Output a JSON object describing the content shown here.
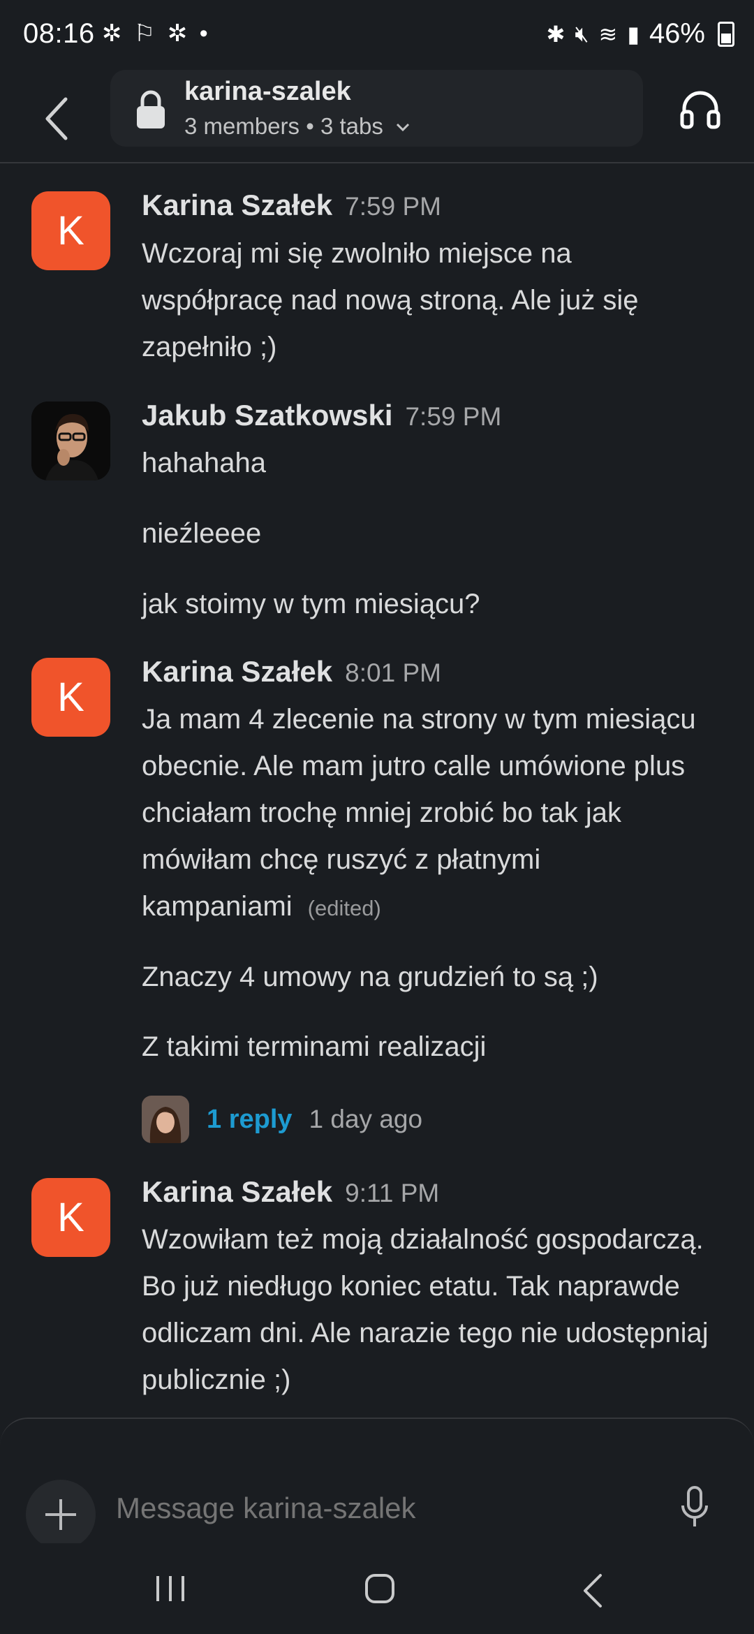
{
  "status": {
    "time": "08:16",
    "left_icons": "✲ ⚐ ✲ •",
    "battery": "46%"
  },
  "header": {
    "channel_name": "karina-szalek",
    "meta": "3 members • 3 tabs"
  },
  "messages": [
    {
      "author": "Karina Szałek",
      "time": "7:59 PM",
      "avatar_letter": "K",
      "lines": [
        "Wczoraj mi się zwolniło miejsce na współpracę nad nową stroną. Ale już się zapełniło ;)"
      ]
    },
    {
      "author": "Jakub Szatkowski",
      "time": "7:59 PM",
      "lines": [
        "hahahaha",
        "nieźleeee",
        "jak stoimy w tym miesiącu?"
      ]
    },
    {
      "author": "Karina Szałek",
      "time": "8:01 PM",
      "avatar_letter": "K",
      "lines": [
        "Ja mam 4 zlecenie na strony w tym miesiącu obecnie. Ale mam jutro calle umówione plus chciałam trochę mniej zrobić bo tak jak mówiłam chcę ruszyć z płatnymi kampaniami",
        "Znaczy 4 umowy na grudzień to są ;)",
        "Z takimi terminami realizacji"
      ],
      "edited": "(edited)",
      "thread": {
        "reply": "1 reply",
        "ago": "1 day ago"
      }
    },
    {
      "author": "Karina Szałek",
      "time": "9:11 PM",
      "avatar_letter": "K",
      "lines": [
        "Wzowiłam też moją działalność gospodarczą. Bo już niedługo koniec etatu. Tak naprawde odliczam dni. Ale narazie tego nie udostępniaj publicznie ;)"
      ]
    }
  ],
  "composer": {
    "placeholder": "Message karina-szalek"
  },
  "icons": {
    "back": "chevron-left-icon",
    "lock": "lock-icon",
    "headphones": "headphones-icon",
    "plus": "plus-icon",
    "mic": "microphone-icon"
  },
  "colors": {
    "background": "#1a1d21",
    "avatar": "#f0542b",
    "link": "#1d9bd1"
  }
}
